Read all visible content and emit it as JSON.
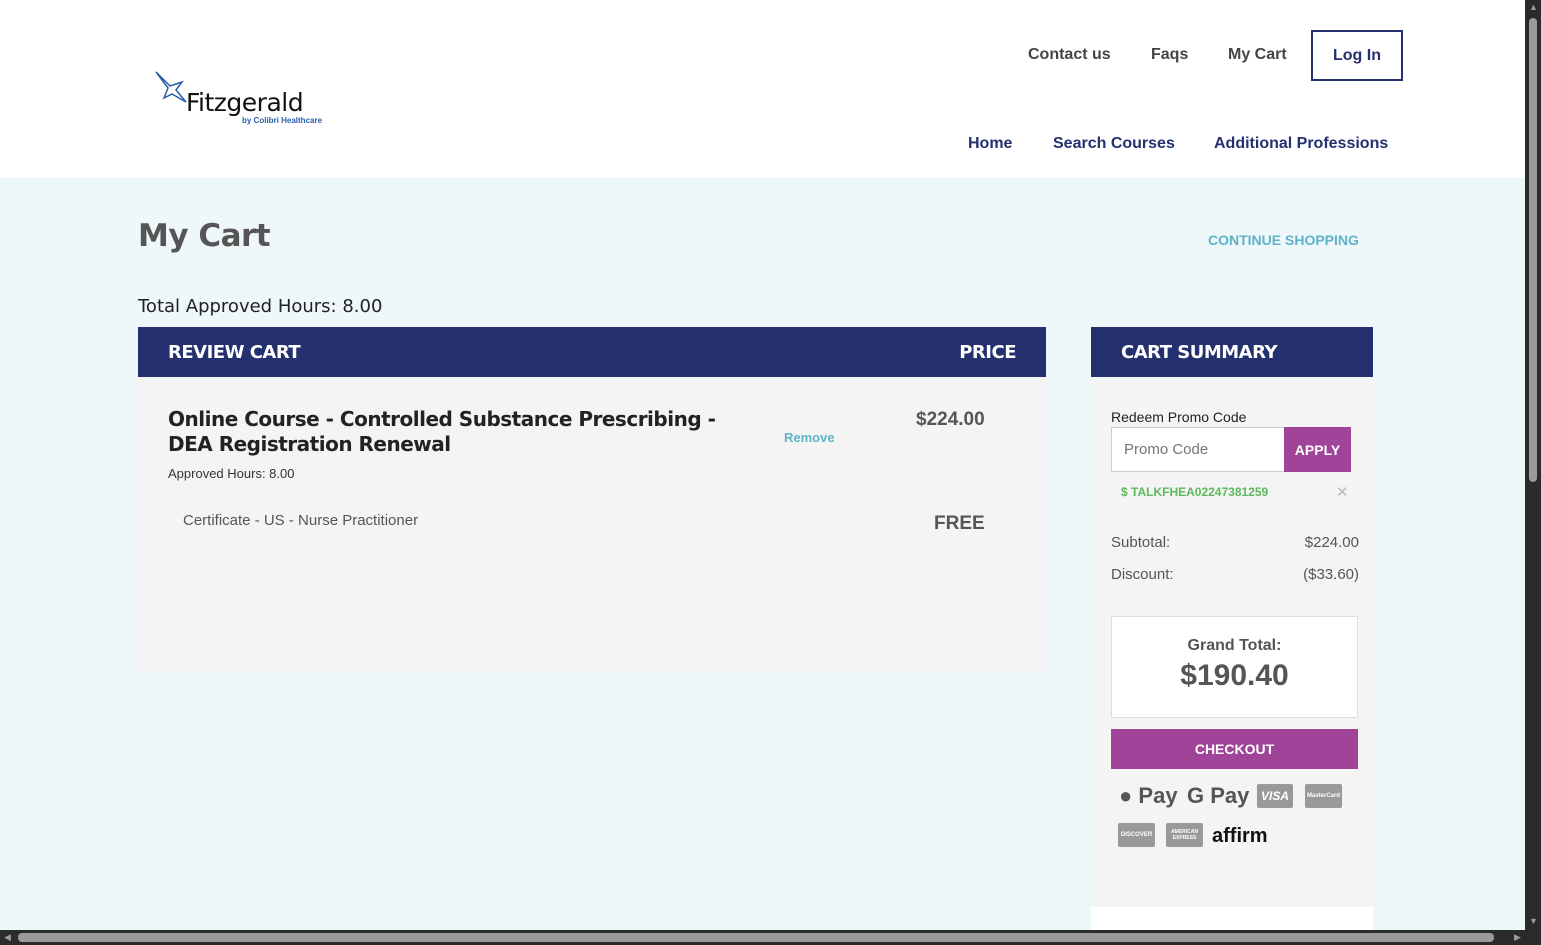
{
  "logo": {
    "name": "Fitzgerald",
    "sub": "by Colibri Healthcare"
  },
  "topnav": {
    "contact": "Contact us",
    "faqs": "Faqs",
    "cart": "My Cart",
    "login": "Log In"
  },
  "mainnav": {
    "home": "Home",
    "search": "Search Courses",
    "additional": "Additional Professions"
  },
  "page": {
    "title": "My Cart",
    "continue": "CONTINUE SHOPPING",
    "total_hours": "Total Approved Hours: 8.00"
  },
  "review": {
    "header": "REVIEW CART",
    "price_header": "PRICE",
    "item": {
      "title": "Online Course - Controlled Substance Prescribing - DEA Registration Renewal",
      "hours": "Approved Hours: 8.00",
      "remove": "Remove",
      "price": "$224.00"
    },
    "cert": {
      "title": "Certificate - US - Nurse Practitioner",
      "price": "FREE"
    }
  },
  "summary": {
    "header": "CART SUMMARY",
    "promo_label": "Redeem Promo Code",
    "promo_placeholder": "Promo Code",
    "apply": "APPLY",
    "applied_code": "$ TALKFHEA02247381259",
    "remove_code": "✕",
    "subtotal_label": "Subtotal:",
    "subtotal": "$224.00",
    "discount_label": "Discount:",
    "discount": "($33.60)",
    "grand_label": "Grand Total:",
    "grand_total": "$190.40",
    "checkout": "CHECKOUT",
    "payments": {
      "apple": " Pay",
      "google": "G Pay",
      "visa": "VISA",
      "mastercard": "MasterCard",
      "discover": "DISCOVER",
      "amex": "AMERICAN EXPRESS",
      "affirm": "affirm"
    }
  }
}
